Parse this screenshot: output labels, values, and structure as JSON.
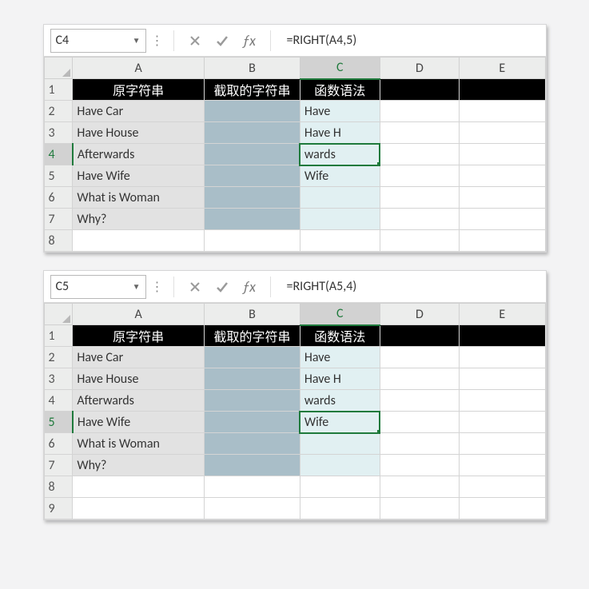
{
  "columnHeaders": [
    "A",
    "B",
    "C",
    "D",
    "E"
  ],
  "sheets": [
    {
      "cellRef": "C4",
      "formula": "=RIGHT(A4,5)",
      "activeRow": 4,
      "rows": [
        {
          "n": 1,
          "A": "原字符串",
          "B": "截取的字符串",
          "C": "函数语法",
          "black": true
        },
        {
          "n": 2,
          "A": "Have Car",
          "B": "",
          "C": "Have",
          "filled": true
        },
        {
          "n": 3,
          "A": "Have House",
          "B": "",
          "C": "Have H",
          "filled": true
        },
        {
          "n": 4,
          "A": "Afterwards",
          "B": "",
          "C": "wards",
          "filled": true
        },
        {
          "n": 5,
          "A": "Have Wife",
          "B": "",
          "C": "Wife",
          "filled": true
        },
        {
          "n": 6,
          "A": "What is Woman",
          "B": "",
          "C": "",
          "filled": true
        },
        {
          "n": 7,
          "A": "Why?",
          "B": "",
          "C": "",
          "filled": true
        },
        {
          "n": 8,
          "A": "",
          "B": "",
          "C": ""
        }
      ]
    },
    {
      "cellRef": "C5",
      "formula": "=RIGHT(A5,4)",
      "activeRow": 5,
      "rows": [
        {
          "n": 1,
          "A": "原字符串",
          "B": "截取的字符串",
          "C": "函数语法",
          "black": true
        },
        {
          "n": 2,
          "A": "Have Car",
          "B": "",
          "C": "Have",
          "filled": true
        },
        {
          "n": 3,
          "A": "Have House",
          "B": "",
          "C": "Have H",
          "filled": true
        },
        {
          "n": 4,
          "A": "Afterwards",
          "B": "",
          "C": "wards",
          "filled": true
        },
        {
          "n": 5,
          "A": "Have Wife",
          "B": "",
          "C": "Wife",
          "filled": true
        },
        {
          "n": 6,
          "A": "What is Woman",
          "B": "",
          "C": "",
          "filled": true
        },
        {
          "n": 7,
          "A": "Why?",
          "B": "",
          "C": "",
          "filled": true
        },
        {
          "n": 8,
          "A": "",
          "B": "",
          "C": ""
        },
        {
          "n": 9,
          "A": "",
          "B": "",
          "C": ""
        }
      ]
    }
  ]
}
